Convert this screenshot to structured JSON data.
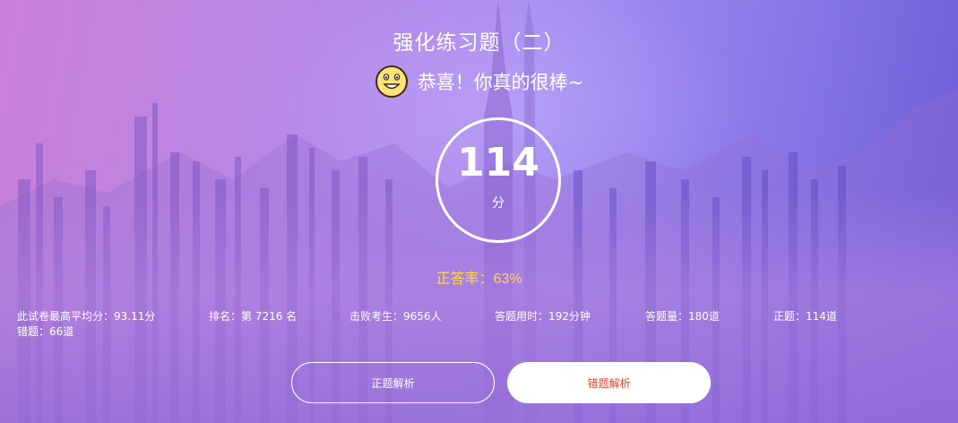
{
  "quiz": {
    "title": "强化练习题（二）"
  },
  "result": {
    "congrats": "恭喜！你真的很棒~",
    "score": "114",
    "score_unit": "分",
    "accuracy": "正答率：63%"
  },
  "stats": [
    "此试卷最高平均分：93.11分",
    "排名：第 7216 名",
    "击败考生：9656人",
    "答题用时：192分钟",
    "答题量：180道",
    "正题：114道",
    "错题：66道"
  ],
  "actions": {
    "correct_review": "正题解析",
    "wrong_review": "错题解析"
  },
  "colors": {
    "accent_yellow": "#ffd84a",
    "wrong_review_text": "#e0453a",
    "background_left": "#c97fd8",
    "background_right": "#6a5bd8"
  },
  "icons": {
    "emoji": "smiling-face-icon"
  }
}
